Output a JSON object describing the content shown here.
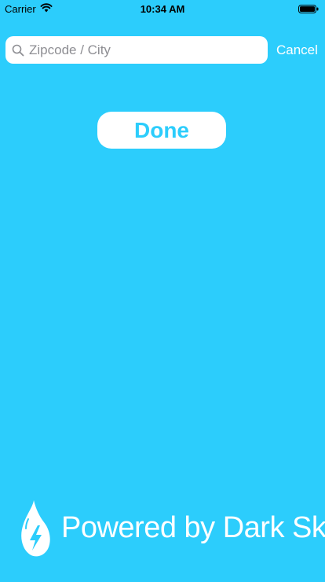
{
  "status_bar": {
    "carrier": "Carrier",
    "time": "10:34 AM",
    "icons": {
      "wifi": "wifi-icon",
      "battery": "battery-icon"
    }
  },
  "search": {
    "placeholder": "Zipcode / City",
    "value": "",
    "cancel_label": "Cancel",
    "icon": "search-icon"
  },
  "done_button": {
    "label": "Done"
  },
  "attribution": {
    "text": "Powered by Dark Sky",
    "logo": "dark-sky-logo"
  },
  "colors": {
    "background": "#2ccdfc",
    "button_bg": "#ffffff",
    "button_text": "#2ccdfc",
    "text_light": "#ffffff"
  }
}
